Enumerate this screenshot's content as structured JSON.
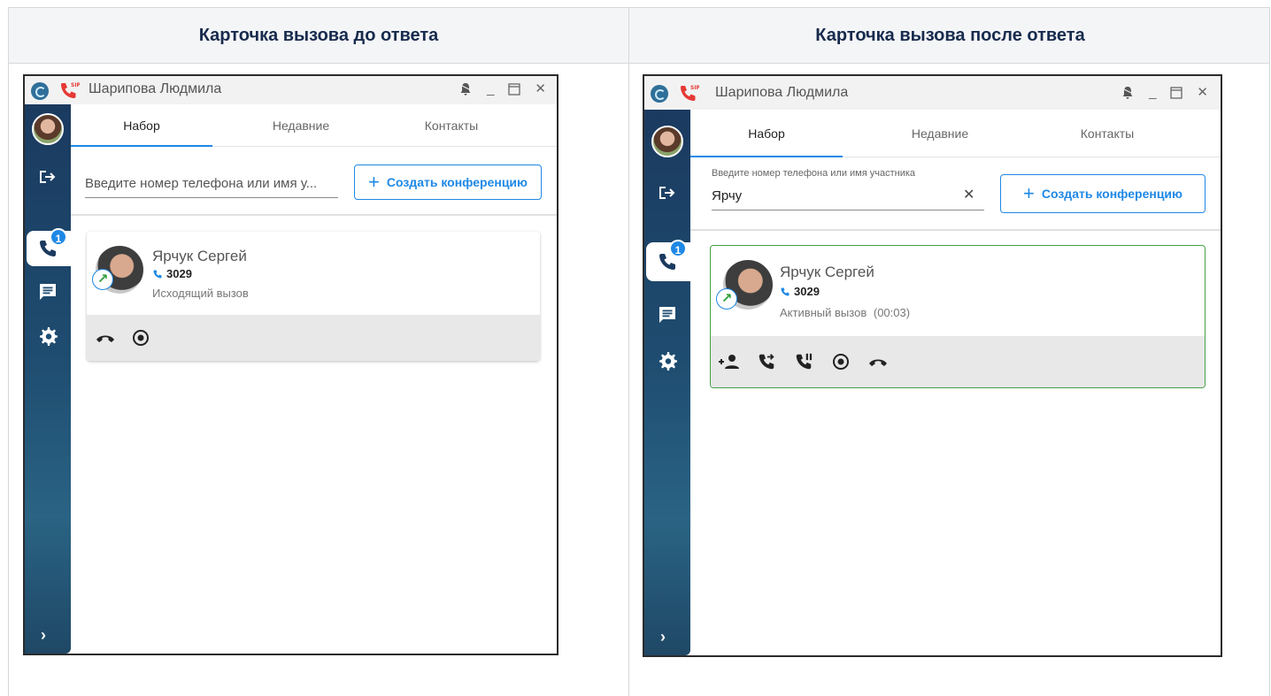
{
  "table": {
    "header_before": "Карточка вызова до ответа",
    "header_after": "Карточка вызова после ответа"
  },
  "window_before": {
    "title": "Шарипова Людмила",
    "tabs": [
      "Набор",
      "Недавние",
      "Контакты"
    ],
    "active_tab": "Набор",
    "search": {
      "placeholder": "Введите номер телефона или имя у..."
    },
    "conference_button": "Создать конференцию",
    "calls_badge": "1",
    "card": {
      "name": "Ярчук Сергей",
      "number": "3029",
      "status": "Исходящий вызов",
      "actions": [
        "hangup-icon",
        "record-icon"
      ]
    }
  },
  "window_after": {
    "title": "Шарипова Людмила",
    "tabs": [
      "Набор",
      "Недавние",
      "Контакты"
    ],
    "active_tab": "Набор",
    "search": {
      "label": "Введите номер телефона или имя участника",
      "value": "Ярчу"
    },
    "conference_button": "Создать конференцию",
    "calls_badge": "1",
    "card": {
      "name": "Ярчук Сергей",
      "number": "3029",
      "status": "Активный вызов",
      "timer": "(00:03)",
      "actions": [
        "add-participant-icon",
        "transfer-call-icon",
        "hold-call-icon",
        "record-icon",
        "hangup-icon"
      ]
    }
  },
  "colors": {
    "accent": "#1e88e5",
    "active_border": "#43a047",
    "sip_red": "#e53935",
    "sidebar": "#1e4c70"
  }
}
